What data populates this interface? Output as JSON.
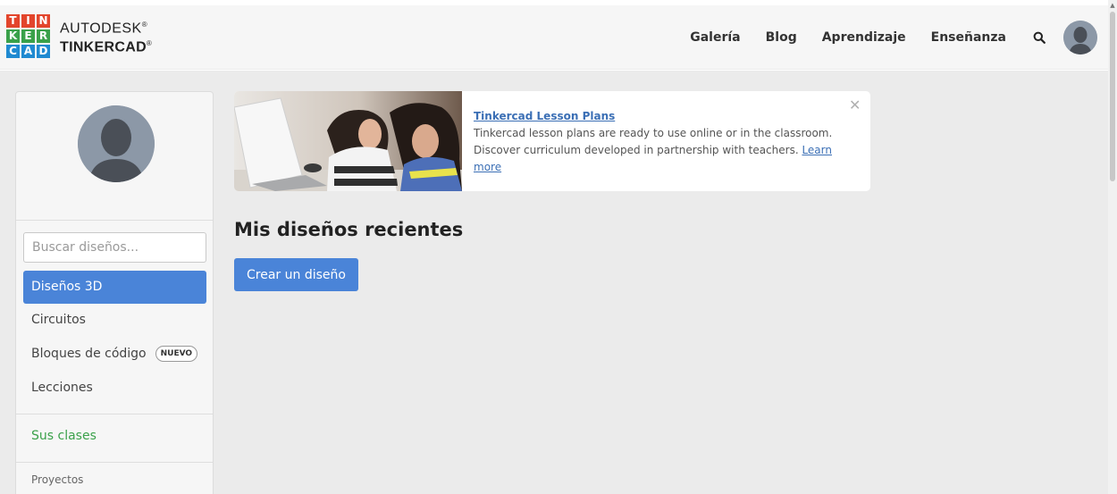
{
  "logo": {
    "letters": [
      "T",
      "I",
      "N",
      "K",
      "E",
      "R",
      "C",
      "A",
      "D"
    ],
    "letter_colors": [
      "#e3452c",
      "#e3452c",
      "#e3452c",
      "#3aa14a",
      "#3aa14a",
      "#3aa14a",
      "#1f8ad1",
      "#1f8ad1",
      "#1f8ad1"
    ],
    "brand": "AUTODESK",
    "brand_mark": "®",
    "product": "TINKERCAD",
    "product_mark": "®"
  },
  "nav": {
    "items": [
      "Galería",
      "Blog",
      "Aprendizaje",
      "Enseñanza"
    ],
    "search_icon": "search-icon",
    "avatar_icon": "user-avatar-icon"
  },
  "sidebar": {
    "search_placeholder": "Buscar diseños...",
    "items": [
      {
        "label": "Diseños 3D",
        "active": true
      },
      {
        "label": "Circuitos",
        "active": false
      },
      {
        "label": "Bloques de código",
        "active": false,
        "badge": "NUEVO"
      },
      {
        "label": "Lecciones",
        "active": false
      }
    ],
    "classes_label": "Sus clases",
    "projects_label": "Proyectos"
  },
  "banner": {
    "title": "Tinkercad Lesson Plans",
    "body": "Tinkercad lesson plans are ready to use online or in the classroom. Discover curriculum developed in partnership with teachers.",
    "link": "Learn more",
    "close_icon": "close-icon"
  },
  "main": {
    "title": "Mis diseños recientes",
    "create_button": "Crear un diseño"
  },
  "colors": {
    "accent": "#4a84d8",
    "green": "#3aa14a",
    "link": "#3b6fb5"
  }
}
